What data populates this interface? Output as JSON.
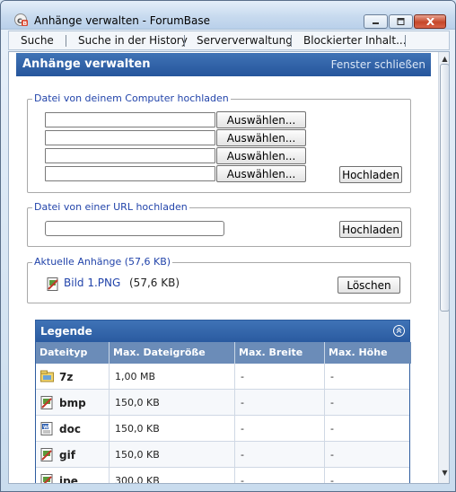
{
  "window": {
    "title": "Anhänge verwalten - ForumBase"
  },
  "menu": {
    "items": [
      "Suche",
      "Suche in der History",
      "Serververwaltung",
      "Blockierter Inhalt..."
    ]
  },
  "header": {
    "title": "Anhänge verwalten",
    "close_link": "Fenster schließen"
  },
  "upload_computer": {
    "legend": "Datei von deinem Computer hochladen",
    "browse_label": "Auswählen...",
    "upload_label": "Hochladen",
    "file_inputs": [
      "",
      "",
      "",
      ""
    ]
  },
  "upload_url": {
    "legend": "Datei von einer URL hochladen",
    "url_value": "",
    "upload_label": "Hochladen"
  },
  "current_attachments": {
    "legend": "Aktuelle Anhänge (57,6 KB)",
    "items": [
      {
        "name": "Bild 1.PNG",
        "size": "(57,6 KB)"
      }
    ],
    "delete_label": "Löschen"
  },
  "legend_table": {
    "title": "Legende",
    "columns": [
      "Dateityp",
      "Max. Dateigröße",
      "Max. Breite",
      "Max. Höhe"
    ],
    "rows": [
      {
        "type": "7z",
        "icon": "archive-icon",
        "max_size": "1,00 MB",
        "max_width": "-",
        "max_height": "-"
      },
      {
        "type": "bmp",
        "icon": "image-file-icon",
        "max_size": "150,0 KB",
        "max_width": "-",
        "max_height": "-"
      },
      {
        "type": "doc",
        "icon": "word-document-icon",
        "max_size": "150,0 KB",
        "max_width": "-",
        "max_height": "-"
      },
      {
        "type": "gif",
        "icon": "image-file-icon",
        "max_size": "150,0 KB",
        "max_width": "-",
        "max_height": "-"
      },
      {
        "type": "jpe",
        "icon": "image-file-icon",
        "max_size": "300,0 KB",
        "max_width": "-",
        "max_height": "-"
      }
    ]
  },
  "colors": {
    "header_blue": "#2e5d9f",
    "legend_text": "#2244aa",
    "column_header": "#6b8cb8"
  }
}
